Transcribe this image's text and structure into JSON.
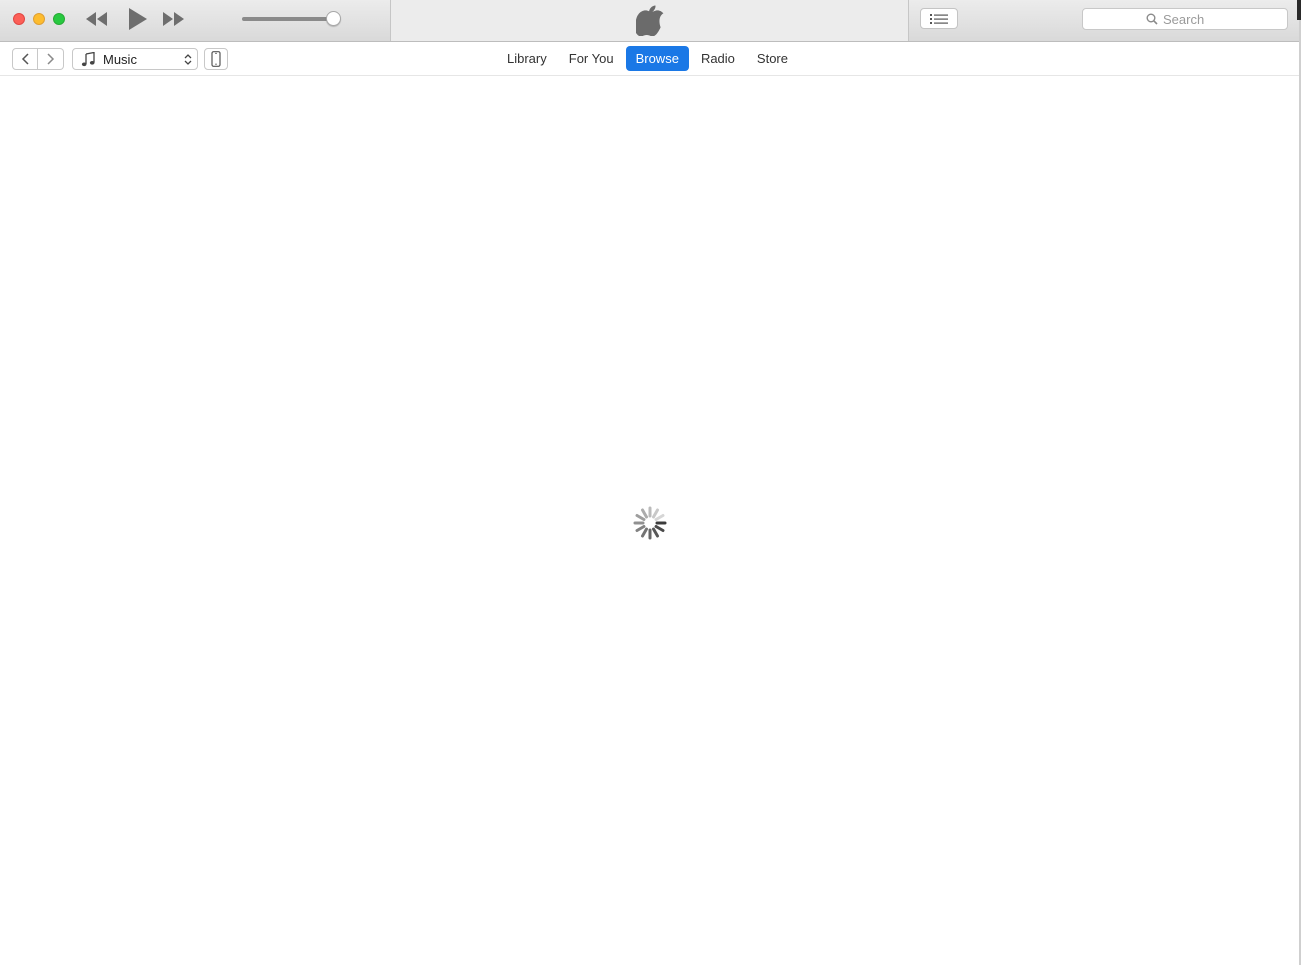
{
  "titlebar": {
    "search_placeholder": "Search"
  },
  "navbar": {
    "media_kind": "Music",
    "tabs": [
      {
        "label": "Library",
        "active": false
      },
      {
        "label": "For You",
        "active": false
      },
      {
        "label": "Browse",
        "active": true
      },
      {
        "label": "Radio",
        "active": false
      },
      {
        "label": "Store",
        "active": false
      }
    ]
  },
  "colors": {
    "accent": "#1a78e6",
    "close": "#fc5f57",
    "minimize": "#fdbc2e",
    "maximize": "#28c940"
  },
  "player": {
    "volume_level": 0.95
  },
  "icons": {
    "rewind": "rewind-icon",
    "play": "play-icon",
    "fast_forward": "fast-forward-icon",
    "apple": "apple-logo-icon",
    "list": "up-next-list-icon",
    "search": "search-icon",
    "back": "chevron-left-icon",
    "forward": "chevron-right-icon",
    "music": "music-note-icon",
    "device": "iphone-icon",
    "loading": "loading-spinner-icon"
  }
}
